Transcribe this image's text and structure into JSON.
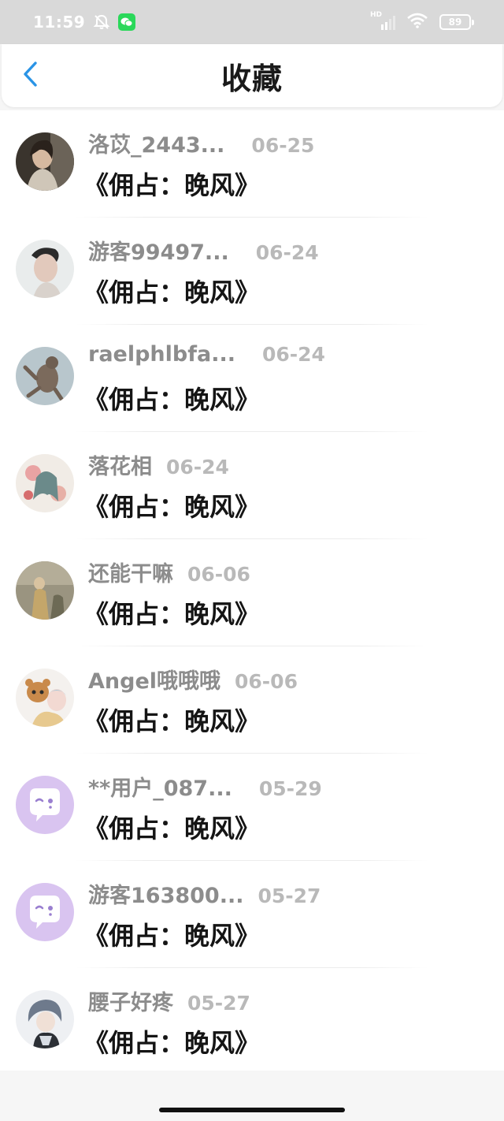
{
  "status_bar": {
    "time": "11:59",
    "network_label": "HD",
    "battery_level": "89",
    "icons": [
      "bell-off-icon",
      "wechat-icon",
      "signal-icon",
      "wifi-icon",
      "battery-icon"
    ]
  },
  "header": {
    "title": "收藏",
    "back_icon": "chevron-left-icon",
    "accent_color": "#2a94e6"
  },
  "favorites": [
    {
      "username": "洛苡_2443...",
      "date": "06-25",
      "title": "《佣占：晚风》",
      "avatar": "girl-portrait"
    },
    {
      "username": "游客99497...",
      "date": "06-24",
      "title": "《佣占：晚风》",
      "avatar": "boy-portrait"
    },
    {
      "username": "raelphlbfa...",
      "date": "06-24",
      "title": "《佣占：晚风》",
      "avatar": "animal-figure"
    },
    {
      "username": "落花相",
      "date": "06-24",
      "title": "《佣占：晚风》",
      "avatar": "anime-girl"
    },
    {
      "username": "还能干嘛",
      "date": "06-06",
      "title": "《佣占：晚风》",
      "avatar": "painting-figures"
    },
    {
      "username": "Angel哦哦哦",
      "date": "06-06",
      "title": "《佣占：晚风》",
      "avatar": "anime-tiger"
    },
    {
      "username": "**用户_087...",
      "date": "05-29",
      "title": "《佣占：晚风》",
      "avatar": "default-chat-bubble"
    },
    {
      "username": "游客163800...",
      "date": "05-27",
      "title": "《佣占：晚风》",
      "avatar": "default-chat-bubble"
    },
    {
      "username": "腰子好疼",
      "date": "05-27",
      "title": "《佣占：晚风》",
      "avatar": "anime-boy"
    }
  ]
}
